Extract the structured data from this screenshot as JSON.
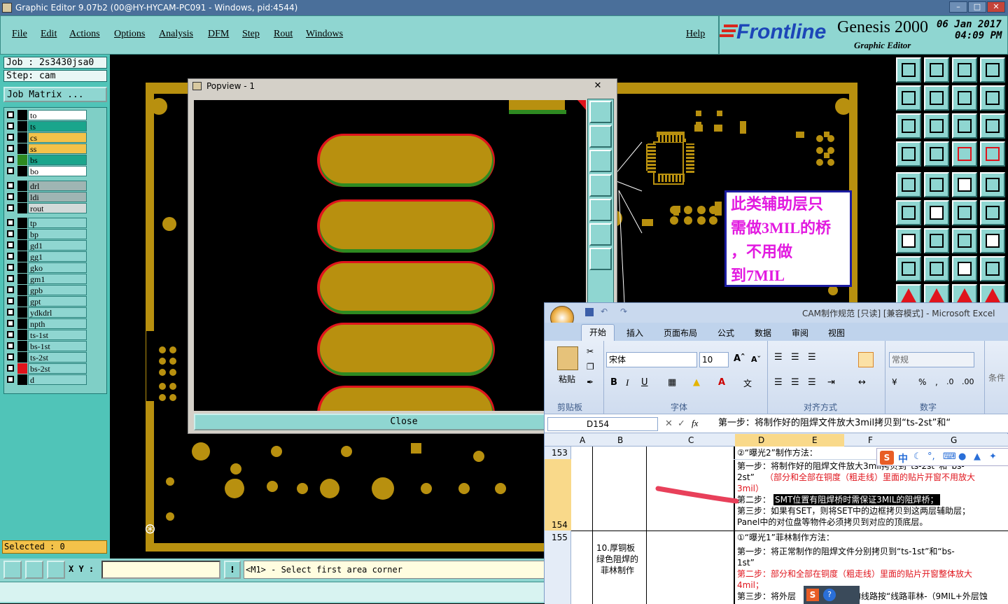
{
  "titlebar": {
    "title": "Graphic Editor 9.07b2 (00@HY-HYCAM-PC091 - Windows, pid:4544)"
  },
  "menu": {
    "items": [
      "File",
      "Edit",
      "Actions",
      "Options",
      "Analysis",
      "DFM",
      "Step",
      "Rout",
      "Windows"
    ],
    "help": "Help"
  },
  "brand": {
    "logo": "Frontline",
    "product": "Genesis 2000",
    "subtitle": "Graphic Editor",
    "date": "06 Jan 2017",
    "time": "04:09 PM"
  },
  "job": {
    "job": "Job : 2s3430jsa0",
    "step": "Step: cam",
    "matrix": "Job Matrix ..."
  },
  "layers": [
    {
      "name": "to",
      "color": "#ffffff",
      "swatch": "#000000",
      "mark": "✦"
    },
    {
      "name": "ts",
      "color": "#1aa58c",
      "swatch": "#000000",
      "mark": ""
    },
    {
      "name": "cs",
      "color": "#f3c24a",
      "swatch": "#000000",
      "mark": "✦"
    },
    {
      "name": "ss",
      "color": "#f3c24a",
      "swatch": "#000000",
      "mark": "✦"
    },
    {
      "name": "bs",
      "color": "#1aa58c",
      "swatch": "#2e8a21",
      "mark": ""
    },
    {
      "name": "bo",
      "color": "#ffffff",
      "swatch": "#000000",
      "mark": ""
    },
    {
      "name": "drl",
      "color": "#9fb5b3",
      "swatch": "#000000",
      "mark": ""
    },
    {
      "name": "ldi",
      "color": "#9fb5b3",
      "swatch": "#000000",
      "mark": ""
    },
    {
      "name": "rout",
      "color": "#d2dad9",
      "swatch": "#000000",
      "mark": ""
    },
    {
      "name": "tp",
      "color": "#8fd6d1",
      "swatch": "#000000",
      "mark": ""
    },
    {
      "name": "bp",
      "color": "#8fd6d1",
      "swatch": "#000000",
      "mark": ""
    },
    {
      "name": "gd1",
      "color": "#8fd6d1",
      "swatch": "#000000",
      "mark": "✦"
    },
    {
      "name": "gg1",
      "color": "#8fd6d1",
      "swatch": "#000000",
      "mark": ""
    },
    {
      "name": "gko",
      "color": "#8fd6d1",
      "swatch": "#000000",
      "mark": ""
    },
    {
      "name": "gm1",
      "color": "#8fd6d1",
      "swatch": "#000000",
      "mark": ""
    },
    {
      "name": "gpb",
      "color": "#8fd6d1",
      "swatch": "#000000",
      "mark": ""
    },
    {
      "name": "gpt",
      "color": "#8fd6d1",
      "swatch": "#000000",
      "mark": ""
    },
    {
      "name": "ydkdrl",
      "color": "#8fd6d1",
      "swatch": "#000000",
      "mark": ""
    },
    {
      "name": "npth",
      "color": "#8fd6d1",
      "swatch": "#000000",
      "mark": ""
    },
    {
      "name": "ts-1st",
      "color": "#8fd6d1",
      "swatch": "#000000",
      "mark": ""
    },
    {
      "name": "bs-1st",
      "color": "#8fd6d1",
      "swatch": "#000000",
      "mark": ""
    },
    {
      "name": "ts-2st",
      "color": "#8fd6d1",
      "swatch": "#000000",
      "mark": ""
    },
    {
      "name": "bs-2st",
      "color": "#8fd6d1",
      "swatch": "#e0141c",
      "mark": "▣"
    },
    {
      "name": "d",
      "color": "#8fd6d1",
      "swatch": "#000000",
      "mark": ""
    }
  ],
  "status": {
    "selected": "Selected : 0",
    "xy_label": "X Y :",
    "prompt": "<M1> - Select first area corner"
  },
  "popview": {
    "title": "Popview - 1",
    "close": "Close"
  },
  "annotation": {
    "lines": [
      "此类辅助层只",
      "需做3MIL的桥",
      "，不用做",
      "到7MIL"
    ]
  },
  "excel": {
    "title": "CAM制作规范  [只读]  [兼容模式] - Microsoft Excel",
    "tabs": [
      "开始",
      "插入",
      "页面布局",
      "公式",
      "数据",
      "审阅",
      "视图"
    ],
    "paste": "粘贴",
    "clipboard": "剪贴板",
    "font_name": "宋体",
    "font_size": "10",
    "font_group": "字体",
    "align_group": "对齐方式",
    "number_format": "常规",
    "number_group": "数字",
    "cond": "条件",
    "namebox": "D154",
    "fx": "fx",
    "formula": "第一步：将制作好的阻焊文件放大3mil拷贝到“ts-2st”和“",
    "columns": [
      "A",
      "B",
      "C",
      "D",
      "E",
      "F",
      "G"
    ],
    "rows": [
      "153",
      "154",
      "155"
    ],
    "row153": "②“曝光2”制作方法：",
    "row154_a": "第一步：将制作好的阻焊文件放大3mil拷贝到“ts-2st”和“bs-",
    "row154_b": "2st”",
    "row154_red": "（部分和全部在铜度（粗走线）里面的贴片开窗不用放大",
    "row154_red2": "3mil）",
    "row154_step2_label": "第二步：",
    "row154_step2": "SMT位置有阻焊桥时需保证3MIL的阻焊桥；",
    "row154_step3": "第三步：如果有SET，则将SET中的边框拷贝到这两层辅助层；",
    "row154_panel": "Panel中的对位盘等物件必须拷贝到对应的顶底层。",
    "row155_b": [
      "10.厚铜板",
      "绿色阻焊的",
      "菲林制作"
    ],
    "row155_title": "①“曝光1”菲林制作方法：",
    "row155_step1": "第一步：将正常制作的阻焊文件分别拷贝到“ts-1st”和“bs-",
    "row155_step1b": "1st”",
    "row155_step2": "第二步：部分和全部在铜度（粗走线）里面的贴片开窗整体放大",
    "row155_step2b": "4mil；",
    "row155_step3": "第三步：将外层",
    "row155_step3b": "的线路按“线路菲林-（9MIL+外层蚀",
    "ime": "中"
  }
}
